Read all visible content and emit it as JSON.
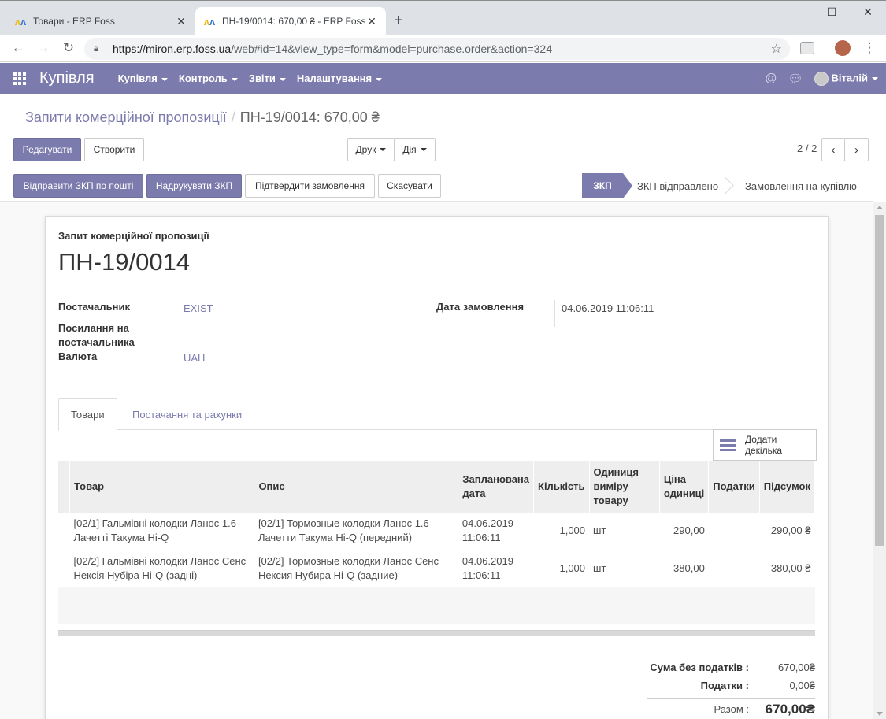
{
  "browser": {
    "tabs": [
      {
        "title": "Товари - ERP Foss",
        "close": "✕"
      },
      {
        "title": "ПН-19/0014: 670,00 ₴ - ERP Foss",
        "close": "✕"
      }
    ],
    "new_tab": "+",
    "url_host": "https://miron.erp.foss.ua",
    "url_path": "/web#id=14&view_type=form&model=purchase.order&action=324"
  },
  "navbar": {
    "app_name": "Купівля",
    "menus": [
      "Купівля",
      "Контроль",
      "Звіти",
      "Налаштування"
    ],
    "user": "Віталій"
  },
  "control_panel": {
    "breadcrumb_parent": "Запити комерційної пропозиції",
    "breadcrumb_current": "ПН-19/0014: 670,00 ₴",
    "edit_label": "Редагувати",
    "create_label": "Створити",
    "print_label": "Друк",
    "action_label": "Дія",
    "pager": "2 / 2"
  },
  "header_buttons": {
    "send_rfq": "Відправити ЗКП по пошті",
    "print_rfq": "Надрукувати ЗКП",
    "confirm": "Підтвердити замовлення",
    "cancel": "Скасувати"
  },
  "statusbar": {
    "stages": [
      "ЗКП",
      "ЗКП відправлено",
      "Замовлення на купівлю"
    ],
    "active_stage": "ЗКП"
  },
  "form": {
    "doc_label": "Запит комерційної пропозиції",
    "doc_name": "ПН-19/0014",
    "vendor_label": "Постачальник",
    "vendor_value": "EXIST",
    "vendor_ref_label_1": "Посилання на",
    "vendor_ref_label_2": "постачальника",
    "currency_label": "Валюта",
    "currency_value": "UAH",
    "order_date_label": "Дата замовлення",
    "order_date_value": "04.06.2019 11:06:11"
  },
  "notebook": {
    "tabs": [
      "Товари",
      "Постачання та рахунки"
    ],
    "add_multiple_1": "Додати",
    "add_multiple_2": "декілька"
  },
  "lines": {
    "headers": {
      "product": "Товар",
      "description": "Опис",
      "date_1": "Запланована",
      "date_2": "дата",
      "qty": "Кількість",
      "uom_1": "Одиниця",
      "uom_2": "виміру",
      "uom_3": "товару",
      "price_1": "Ціна",
      "price_2": "одиниці",
      "taxes": "Податки",
      "subtotal": "Підсумок"
    },
    "rows": [
      {
        "product_1": "[02/1] Гальмівні колодки Ланос 1.6",
        "product_2": "Лачетті Такума Hi-Q",
        "desc_1": "[02/1] Тормозные колодки Ланос 1.6",
        "desc_2": "Лачетти Такума Hi-Q (передний)",
        "date_1": "04.06.2019",
        "date_2": "11:06:11",
        "qty": "1,000",
        "uom": "шт",
        "price": "290,00",
        "taxes": "",
        "subtotal": "290,00 ₴"
      },
      {
        "product_1": "[02/2] Гальмівні колодки Ланос Сенс",
        "product_2": "Нексія Нубіра Hi-Q (задні)",
        "desc_1": "[02/2] Тормозные колодки Ланос Сенс",
        "desc_2": "Нексия Нубира Hi-Q (задние)",
        "date_1": "04.06.2019",
        "date_2": "11:06:11",
        "qty": "1,000",
        "uom": "шт",
        "price": "380,00",
        "taxes": "",
        "subtotal": "380,00 ₴"
      }
    ]
  },
  "totals": {
    "untaxed_label": "Сума без податків :",
    "untaxed_value": "670,00₴",
    "taxes_label": "Податки :",
    "taxes_value": "0,00₴",
    "total_label": "Разом :",
    "total_value": "670,00₴"
  },
  "colors": {
    "brand": "#7c7bad"
  }
}
